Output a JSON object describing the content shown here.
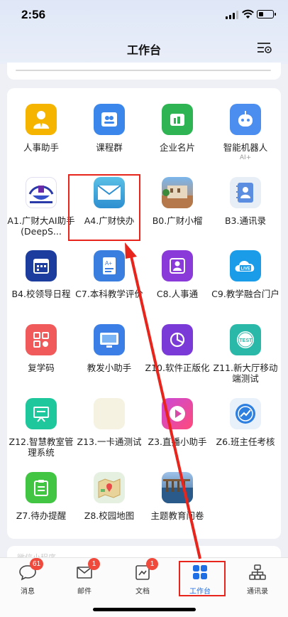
{
  "status_bar": {
    "time": "2:56"
  },
  "header": {
    "title": "工作台"
  },
  "apps": [
    {
      "label": "人事助手"
    },
    {
      "label": "课程群"
    },
    {
      "label": "企业名片"
    },
    {
      "label": "智能机器人",
      "sub": "AI+"
    },
    {
      "label": "A1.广财大AI助手 (DeepS..."
    },
    {
      "label": "A4.广财快办"
    },
    {
      "label": "B0.广财小榴"
    },
    {
      "label": "B3.通讯录"
    },
    {
      "label": "B4.校领导日程"
    },
    {
      "label": "C7.本科教学评价"
    },
    {
      "label": "C8.人事通"
    },
    {
      "label": "C9.教学融合门户"
    },
    {
      "label": "复学码"
    },
    {
      "label": "教发小助手"
    },
    {
      "label": "Z10.软件正版化"
    },
    {
      "label": "Z11.新大厅移动端测试"
    },
    {
      "label": "Z12.智慧教室管理系统"
    },
    {
      "label": "Z13.一卡通测试"
    },
    {
      "label": "Z3.直播小助手"
    },
    {
      "label": "Z6.班主任考核"
    },
    {
      "label": "Z7.待办提醒"
    },
    {
      "label": "Z8.校园地图"
    },
    {
      "label": "主题教育问卷"
    }
  ],
  "next_section": {
    "label": "微信小程序"
  },
  "tabbar": {
    "items": [
      {
        "label": "消息",
        "badge": "61"
      },
      {
        "label": "邮件",
        "badge": "1"
      },
      {
        "label": "文档",
        "badge": "1"
      },
      {
        "label": "工作台",
        "badge": ""
      },
      {
        "label": "通讯录",
        "badge": ""
      }
    ],
    "active": "工作台",
    "active_color": "#1e6ee6"
  },
  "colors": {
    "annotation": "#e8251c",
    "accent": "#1e6ee6"
  }
}
